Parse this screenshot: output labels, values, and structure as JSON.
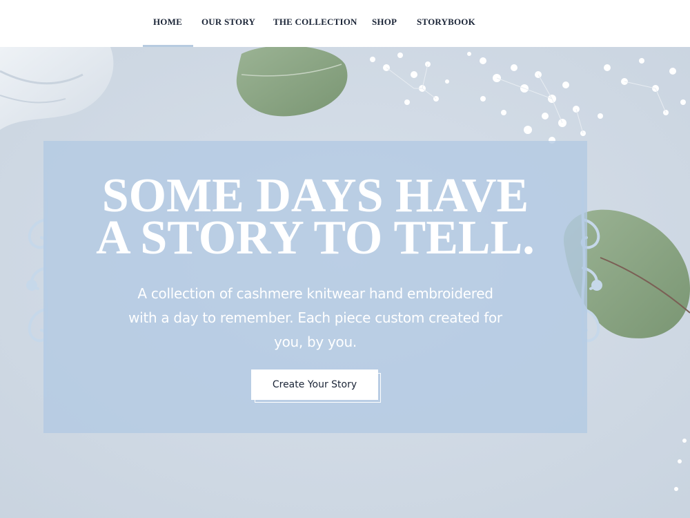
{
  "nav": {
    "items": [
      {
        "label": "HOME",
        "active": true
      },
      {
        "label": "OUR STORY",
        "active": false
      },
      {
        "label": "THE COLLECTION",
        "active": false
      },
      {
        "label": "SHOP",
        "active": false
      },
      {
        "label": "STORYBOOK",
        "active": false
      }
    ]
  },
  "hero": {
    "headline_line1": "SOME DAYS HAVE",
    "headline_line2": "A STORY TO TELL.",
    "subtext_line1": "A collection of cashmere knitwear hand embroidered",
    "subtext_line2": "with a day to remember. Each piece custom created for",
    "subtext_line3": "you, by you.",
    "cta_label": "Create Your Story"
  },
  "colors": {
    "nav_text": "#1b2537",
    "active_underline": "#b7cbe0",
    "hero_background": "#d2dbe5",
    "panel": "#b2c9e3",
    "leaf": "#8ea887",
    "flowers": "#ffffff"
  },
  "icons": [
    "eucalyptus-leaf",
    "babys-breath-flowers",
    "silk-fabric",
    "ornamental-scroll"
  ]
}
